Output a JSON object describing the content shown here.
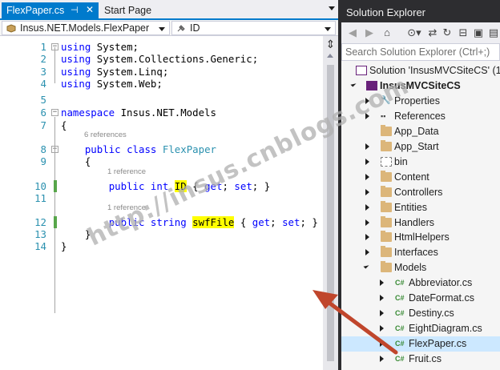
{
  "editor": {
    "tabs": [
      {
        "label": "FlexPaper.cs",
        "active": true
      },
      {
        "label": "Start Page",
        "active": false
      }
    ],
    "nav_class": "Insus.NET.Models.FlexPaper",
    "nav_member": "ID",
    "lines": [
      {
        "n": "1",
        "tokens": [
          [
            "kw",
            "using"
          ],
          [
            "t",
            " System;"
          ]
        ]
      },
      {
        "n": "2",
        "tokens": [
          [
            "kw",
            "using"
          ],
          [
            "t",
            " System.Collections.Generic;"
          ]
        ]
      },
      {
        "n": "3",
        "tokens": [
          [
            "kw",
            "using"
          ],
          [
            "t",
            " System.Linq;"
          ]
        ]
      },
      {
        "n": "4",
        "tokens": [
          [
            "kw",
            "using"
          ],
          [
            "t",
            " System.Web;"
          ]
        ]
      },
      {
        "n": "5",
        "tokens": []
      },
      {
        "n": "6",
        "tokens": [
          [
            "kw",
            "namespace"
          ],
          [
            "t",
            " Insus.NET.Models"
          ]
        ]
      },
      {
        "n": "7",
        "tokens": [
          [
            "t",
            "{"
          ]
        ]
      },
      {
        "n": "8",
        "tokens": [
          [
            "t",
            "    "
          ],
          [
            "kw",
            "public"
          ],
          [
            "t",
            " "
          ],
          [
            "kw",
            "class"
          ],
          [
            "t",
            " "
          ],
          [
            "ty",
            "FlexPaper"
          ]
        ]
      },
      {
        "n": "9",
        "tokens": [
          [
            "t",
            "    {"
          ]
        ]
      },
      {
        "n": "10",
        "tokens": [
          [
            "t",
            "        "
          ],
          [
            "kw",
            "public"
          ],
          [
            "t",
            " "
          ],
          [
            "kw",
            "int"
          ],
          [
            "t",
            " "
          ],
          [
            "hl",
            "ID"
          ],
          [
            "t",
            " { "
          ],
          [
            "kw",
            "get"
          ],
          [
            "t",
            "; "
          ],
          [
            "kw",
            "set"
          ],
          [
            "t",
            "; }"
          ]
        ]
      },
      {
        "n": "11",
        "tokens": []
      },
      {
        "n": "12",
        "tokens": [
          [
            "t",
            "        "
          ],
          [
            "kw",
            "public"
          ],
          [
            "t",
            " "
          ],
          [
            "kw",
            "string"
          ],
          [
            "t",
            " "
          ],
          [
            "hl",
            "swfFile"
          ],
          [
            "t",
            " { "
          ],
          [
            "kw",
            "get"
          ],
          [
            "t",
            "; "
          ],
          [
            "kw",
            "set"
          ],
          [
            "t",
            "; }"
          ]
        ]
      },
      {
        "n": "13",
        "tokens": [
          [
            "t",
            "    }"
          ]
        ]
      },
      {
        "n": "14",
        "tokens": [
          [
            "t",
            "}"
          ]
        ]
      }
    ],
    "codelens": [
      "6 references",
      "1 reference",
      "1 reference"
    ]
  },
  "solution_explorer": {
    "title": "Solution Explorer",
    "search_placeholder": "Search Solution Explorer (Ctrl+;)",
    "tree": [
      {
        "label": "Solution 'InsusMVCSiteCS' (1",
        "level": 0,
        "icon": "solution-icon",
        "expander": "none"
      },
      {
        "label": "InsusMVCSiteCS",
        "level": 1,
        "icon": "project-icon",
        "expander": "open",
        "bold": true
      },
      {
        "label": "Properties",
        "level": 2,
        "icon": "wrench-icon",
        "expander": "closed"
      },
      {
        "label": "References",
        "level": 2,
        "icon": "references-icon",
        "expander": "closed"
      },
      {
        "label": "App_Data",
        "level": 2,
        "icon": "folder-icon",
        "expander": "none"
      },
      {
        "label": "App_Start",
        "level": 2,
        "icon": "folder-icon",
        "expander": "closed"
      },
      {
        "label": "bin",
        "level": 2,
        "icon": "hidden-folder-icon",
        "expander": "closed"
      },
      {
        "label": "Content",
        "level": 2,
        "icon": "folder-icon",
        "expander": "closed"
      },
      {
        "label": "Controllers",
        "level": 2,
        "icon": "folder-icon",
        "expander": "closed"
      },
      {
        "label": "Entities",
        "level": 2,
        "icon": "folder-icon",
        "expander": "closed"
      },
      {
        "label": "Handlers",
        "level": 2,
        "icon": "folder-icon",
        "expander": "closed"
      },
      {
        "label": "HtmlHelpers",
        "level": 2,
        "icon": "folder-icon",
        "expander": "closed"
      },
      {
        "label": "Interfaces",
        "level": 2,
        "icon": "folder-icon",
        "expander": "closed"
      },
      {
        "label": "Models",
        "level": 2,
        "icon": "open-folder-icon",
        "expander": "open"
      },
      {
        "label": "Abbreviator.cs",
        "level": 3,
        "icon": "csharp-file-icon",
        "expander": "closed"
      },
      {
        "label": "DateFormat.cs",
        "level": 3,
        "icon": "csharp-file-icon",
        "expander": "closed"
      },
      {
        "label": "Destiny.cs",
        "level": 3,
        "icon": "csharp-file-icon",
        "expander": "closed"
      },
      {
        "label": "EightDiagram.cs",
        "level": 3,
        "icon": "csharp-file-icon",
        "expander": "closed"
      },
      {
        "label": "FlexPaper.cs",
        "level": 3,
        "icon": "csharp-file-icon",
        "expander": "closed",
        "selected": true
      },
      {
        "label": "Fruit.cs",
        "level": 3,
        "icon": "csharp-file-icon",
        "expander": "closed"
      }
    ]
  },
  "watermark": "http://insus.cnblogs.com",
  "colors": {
    "accent": "#007acc",
    "arrow": "#c0462c",
    "keyword": "#0000ff",
    "type": "#2b91af",
    "highlight": "#ffff00"
  }
}
